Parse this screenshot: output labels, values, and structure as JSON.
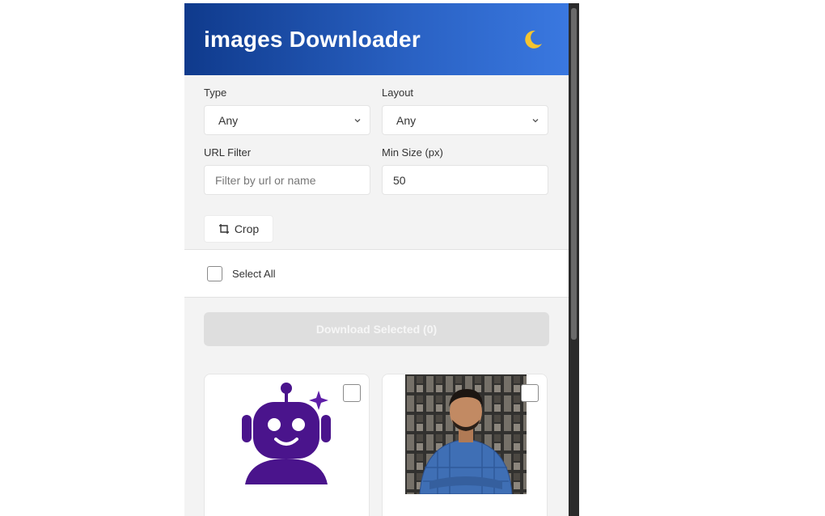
{
  "header": {
    "title": "images Downloader",
    "theme_icon": "moon-icon",
    "colors": {
      "gradient_start": "#0f3a8c",
      "gradient_end": "#3a78e0"
    }
  },
  "filters": {
    "type": {
      "label": "Type",
      "value": "Any"
    },
    "layout": {
      "label": "Layout",
      "value": "Any"
    },
    "url_filter": {
      "label": "URL Filter",
      "placeholder": "Filter by url or name",
      "value": ""
    },
    "min_size": {
      "label": "Min Size (px)",
      "value": "50"
    }
  },
  "crop": {
    "label": "Crop",
    "icon": "crop-icon"
  },
  "select_all": {
    "label": "Select All",
    "checked": false
  },
  "download": {
    "label": "Download Selected (0)",
    "enabled": false
  },
  "images": [
    {
      "kind": "robot-logo",
      "checked": false
    },
    {
      "kind": "person-photo",
      "checked": false
    }
  ]
}
